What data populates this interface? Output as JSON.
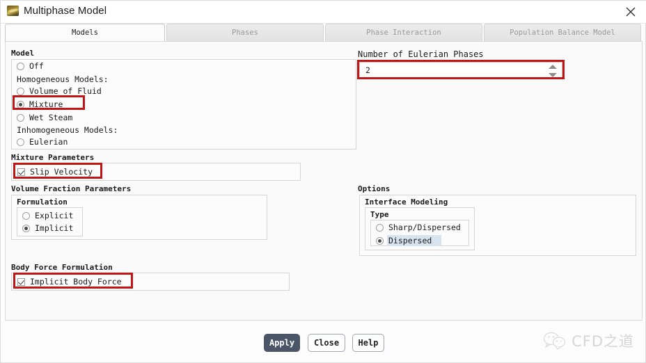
{
  "window": {
    "title": "Multiphase Model",
    "app_icon": "fluent-icon",
    "close_icon": "close-icon"
  },
  "tabs": [
    {
      "label": "Models",
      "active": true
    },
    {
      "label": "Phases",
      "active": false
    },
    {
      "label": "Phase Interaction",
      "active": false
    },
    {
      "label": "Population Balance Model",
      "active": false
    }
  ],
  "model_group": {
    "title": "Model",
    "options": [
      {
        "label": "Off",
        "type": "radio",
        "selected": false
      },
      {
        "label": "Homogeneous Models:",
        "type": "text"
      },
      {
        "label": "Volume of Fluid",
        "type": "radio",
        "selected": false
      },
      {
        "label": "Mixture",
        "type": "radio",
        "selected": true,
        "highlighted": true
      },
      {
        "label": "Wet Steam",
        "type": "radio",
        "selected": false
      },
      {
        "label": "Inhomogeneous Models:",
        "type": "text"
      },
      {
        "label": "Eulerian",
        "type": "radio",
        "selected": false
      }
    ]
  },
  "mixture_parameters": {
    "title": "Mixture Parameters",
    "slip_velocity": {
      "label": "Slip Velocity",
      "checked": true,
      "highlighted": true
    }
  },
  "volume_fraction_parameters": {
    "title": "Volume Fraction Parameters",
    "formulation": {
      "title": "Formulation",
      "options": [
        {
          "label": "Explicit",
          "selected": false
        },
        {
          "label": "Implicit",
          "selected": true
        }
      ]
    }
  },
  "body_force_formulation": {
    "title": "Body Force Formulation",
    "implicit_body_force": {
      "label": "Implicit Body Force",
      "checked": true,
      "highlighted": true
    }
  },
  "eulerian_phases": {
    "title": "Number of Eulerian Phases",
    "value": "2",
    "highlighted": true,
    "spinner_up_icon": "chevron-up-icon",
    "spinner_down_icon": "chevron-down-icon"
  },
  "options_group": {
    "title": "Options",
    "interface_modeling": {
      "title": "Interface Modeling",
      "type_group": {
        "title": "Type",
        "options": [
          {
            "label": "Sharp/Dispersed",
            "selected": false,
            "focused": false
          },
          {
            "label": "Dispersed",
            "selected": true,
            "focused": true
          }
        ]
      }
    }
  },
  "footer": {
    "apply_label": "Apply",
    "close_label": "Close",
    "help_label": "Help"
  },
  "watermark": {
    "text": "CFD之道",
    "icon": "wechat-icon"
  },
  "colors": {
    "highlight_red": "#c01616",
    "primary_button": "#4a5568",
    "selection_blue": "#d7e3ef"
  }
}
